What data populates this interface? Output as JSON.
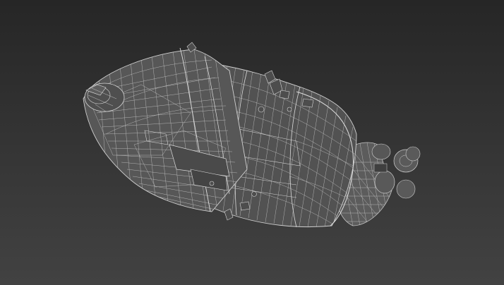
{
  "viewport": {
    "background_top": "#262626",
    "background_bottom": "#424242",
    "wire_color": "#b4b4b4",
    "shading": "wireframe"
  },
  "model": {
    "icon": "spacecraft-wireframe-icon"
  }
}
